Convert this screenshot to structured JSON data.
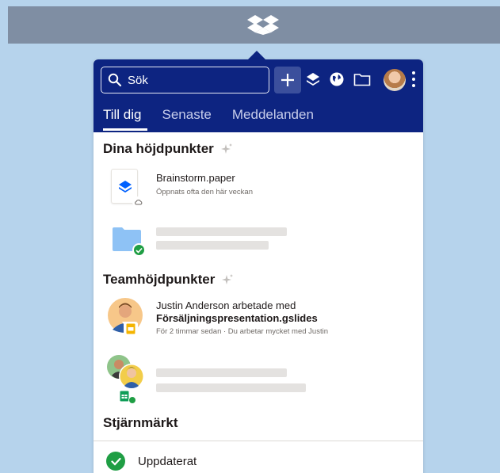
{
  "menubar": {
    "icon": "dropbox-logo-icon"
  },
  "header": {
    "search": {
      "placeholder": "Sök",
      "icon": "search-icon"
    },
    "icons": [
      "plus-icon",
      "layers-icon",
      "globe-icon",
      "folder-icon",
      "avatar",
      "more-vertical-icon"
    ],
    "tabs": [
      {
        "label": "Till dig",
        "active": true
      },
      {
        "label": "Senaste",
        "active": false
      },
      {
        "label": "Meddelanden",
        "active": false
      }
    ]
  },
  "sections": {
    "highlights": {
      "title": "Dina höjdpunkter",
      "items": [
        {
          "title": "Brainstorm.paper",
          "subtitle": "Öppnats ofta den här veckan",
          "icon": "paper-doc-icon",
          "badge": "cloud-icon"
        },
        {
          "icon": "folder-icon",
          "badge": "check-icon",
          "placeholder": true
        }
      ]
    },
    "team": {
      "title": "Teamhöjdpunkter",
      "items": [
        {
          "title": "Justin Anderson arbetade med",
          "file": "Försäljningspresentation.gslides",
          "subtitle": "För 2 timmar sedan · Du arbetar mycket med Justin",
          "icon": "avatar",
          "badge": "slides-icon"
        },
        {
          "icon": "avatar-group",
          "badge": "sheets-icon",
          "placeholder": true
        }
      ]
    },
    "starred": {
      "title": "Stjärnmärkt"
    }
  },
  "footer": {
    "status": "Uppdaterat",
    "icon": "check-circle-icon"
  },
  "colors": {
    "header": "#0d2481",
    "background": "#b6d3ec",
    "menubar": "#7f8ea3",
    "success": "#1f9e44",
    "folder": "#8ec2f5"
  }
}
